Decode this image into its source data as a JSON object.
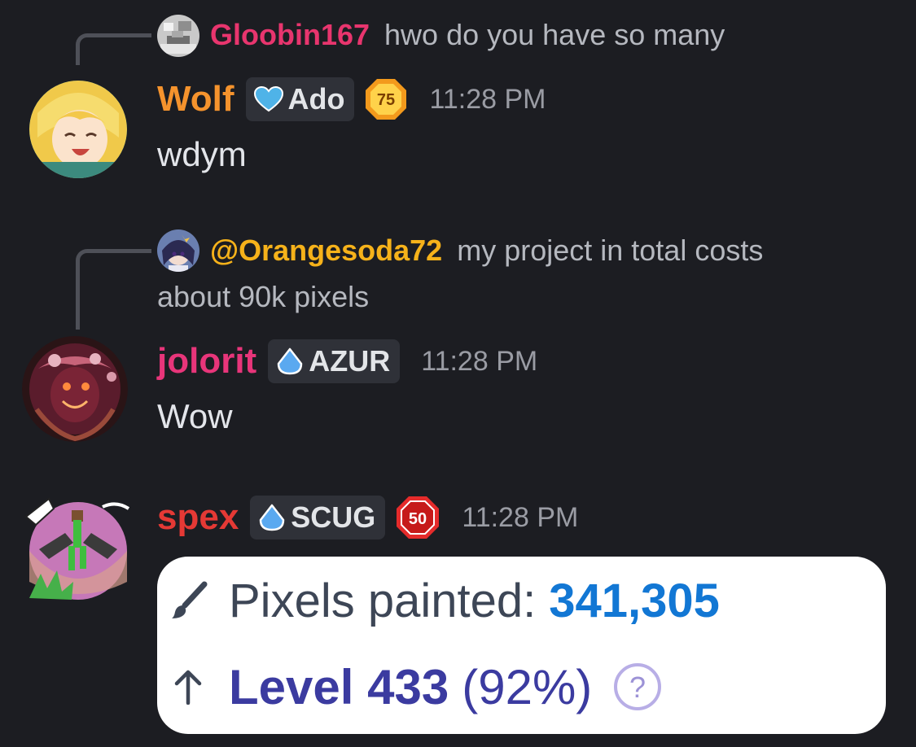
{
  "colors": {
    "background": "#1c1d22",
    "gloobin": "#e8356e",
    "wolf": "#f5932d",
    "orangesoda": "#f6b21a",
    "jolorit": "#e8357a",
    "spex": "#e53935",
    "pixels_value": "#1277d4",
    "level": "#3b3ba0"
  },
  "messages": [
    {
      "reply": {
        "author": "Gloobin167",
        "text": "hwo do you have so many",
        "avatar_icon": "gloobin-avatar-icon"
      },
      "author": "Wolf",
      "tag": {
        "label": "Ado",
        "icon": "heart-icon"
      },
      "level_badge": "75",
      "time": "11:28 PM",
      "text": "wdym",
      "avatar_icon": "wolf-avatar-icon"
    },
    {
      "reply": {
        "author": "@Orangesoda72",
        "text_line1": "my project in total costs",
        "text_line2": "about 90k pixels",
        "avatar_icon": "orangesoda-avatar-icon"
      },
      "author": "jolorit",
      "tag": {
        "label": "AZUR",
        "icon": "droplet-icon"
      },
      "time": "11:28 PM",
      "text": "Wow",
      "avatar_icon": "jolorit-avatar-icon"
    },
    {
      "author": "spex",
      "tag": {
        "label": "SCUG",
        "icon": "droplet-icon"
      },
      "level_badge": "50",
      "time": "11:28 PM",
      "avatar_icon": "spex-avatar-icon",
      "card": {
        "pixels_label": "Pixels painted:",
        "pixels_value": "341,305",
        "level_label": "Level 433",
        "level_percent": "(92%)",
        "brush_icon": "brush-icon",
        "arrow_icon": "arrow-up-icon",
        "help_icon": "question-icon"
      }
    }
  ]
}
